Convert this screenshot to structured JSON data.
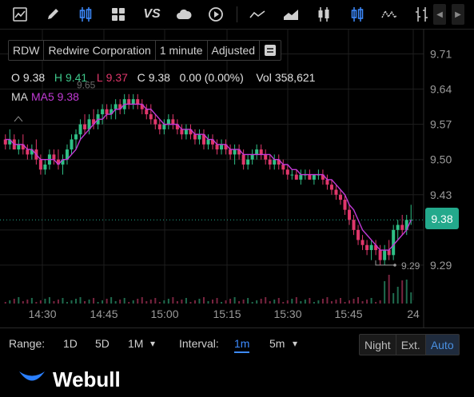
{
  "toolbar": {
    "icons": [
      "area-chart-icon",
      "draw-pen-icon",
      "candlestick-icon",
      "grid-layout-icon",
      "compare-vs-icon",
      "cloud-icon",
      "replay-icon",
      "line-chart-icon",
      "mountain-chart-icon",
      "bar-ohlc-icon",
      "candle-selected-icon",
      "wave-chart-icon",
      "hollow-candle-icon"
    ],
    "compare_label": "VS",
    "nav_left": "◀",
    "nav_right": "▶"
  },
  "info": {
    "symbol": "RDW",
    "name": "Redwire Corporation",
    "interval": "1 minute",
    "adjust": "Adjusted",
    "menu_icon": "≡"
  },
  "ohlc": {
    "o_label": "O",
    "o": "9.38",
    "h_label": "H",
    "h": "9.41",
    "l_label": "L",
    "l": "9.37",
    "c_label": "C",
    "c": "9.38",
    "change": "0.00 (0.00%)",
    "vol_label": "Vol",
    "vol": "358,621"
  },
  "ma": {
    "label": "MA",
    "value": "MA5 9.38"
  },
  "price_badge": "9.38",
  "chart_data": {
    "type": "candlestick",
    "y_ticks": [
      "9.71",
      "9.64",
      "9.57",
      "9.50",
      "9.43",
      "9.38",
      "9.29"
    ],
    "x_ticks": [
      "14:30",
      "14:45",
      "15:00",
      "15:15",
      "15:30",
      "15:45",
      "24"
    ],
    "high_label": "9.65",
    "low_label": "9.29",
    "last_price": 9.38,
    "colors": {
      "up": "#2fbf86",
      "down": "#e0376b",
      "ma": "#c23ad6",
      "grid": "#1e1e1e",
      "last": "#23a98c"
    },
    "candles": [
      [
        9.54,
        9.55,
        9.52,
        9.53
      ],
      [
        9.53,
        9.56,
        9.52,
        9.54
      ],
      [
        9.54,
        9.55,
        9.52,
        9.52
      ],
      [
        9.52,
        9.54,
        9.51,
        9.53
      ],
      [
        9.53,
        9.55,
        9.51,
        9.52
      ],
      [
        9.52,
        9.53,
        9.5,
        9.51
      ],
      [
        9.51,
        9.53,
        9.5,
        9.52
      ],
      [
        9.52,
        9.54,
        9.49,
        9.5
      ],
      [
        9.5,
        9.51,
        9.47,
        9.48
      ],
      [
        9.48,
        9.5,
        9.47,
        9.49
      ],
      [
        9.49,
        9.52,
        9.48,
        9.51
      ],
      [
        9.51,
        9.52,
        9.49,
        9.5
      ],
      [
        9.5,
        9.52,
        9.48,
        9.49
      ],
      [
        9.49,
        9.51,
        9.47,
        9.5
      ],
      [
        9.5,
        9.53,
        9.49,
        9.52
      ],
      [
        9.52,
        9.55,
        9.51,
        9.54
      ],
      [
        9.54,
        9.56,
        9.52,
        9.55
      ],
      [
        9.55,
        9.58,
        9.54,
        9.57
      ],
      [
        9.57,
        9.59,
        9.55,
        9.56
      ],
      [
        9.56,
        9.59,
        9.55,
        9.58
      ],
      [
        9.58,
        9.6,
        9.56,
        9.57
      ],
      [
        9.57,
        9.6,
        9.56,
        9.59
      ],
      [
        9.59,
        9.61,
        9.57,
        9.6
      ],
      [
        9.6,
        9.61,
        9.58,
        9.59
      ],
      [
        9.59,
        9.61,
        9.58,
        9.6
      ],
      [
        9.6,
        9.62,
        9.58,
        9.61
      ],
      [
        9.61,
        9.62,
        9.59,
        9.6
      ],
      [
        9.6,
        9.63,
        9.59,
        9.62
      ],
      [
        9.62,
        9.63,
        9.6,
        9.61
      ],
      [
        9.61,
        9.63,
        9.6,
        9.62
      ],
      [
        9.62,
        9.63,
        9.6,
        9.61
      ],
      [
        9.61,
        9.62,
        9.59,
        9.6
      ],
      [
        9.6,
        9.61,
        9.58,
        9.59
      ],
      [
        9.59,
        9.61,
        9.57,
        9.58
      ],
      [
        9.58,
        9.59,
        9.56,
        9.57
      ],
      [
        9.57,
        9.58,
        9.55,
        9.56
      ],
      [
        9.56,
        9.58,
        9.55,
        9.57
      ],
      [
        9.57,
        9.59,
        9.56,
        9.58
      ],
      [
        9.58,
        9.59,
        9.56,
        9.57
      ],
      [
        9.57,
        9.58,
        9.55,
        9.56
      ],
      [
        9.56,
        9.57,
        9.54,
        9.55
      ],
      [
        9.55,
        9.57,
        9.54,
        9.56
      ],
      [
        9.56,
        9.57,
        9.54,
        9.55
      ],
      [
        9.55,
        9.56,
        9.53,
        9.54
      ],
      [
        9.54,
        9.56,
        9.53,
        9.55
      ],
      [
        9.55,
        9.56,
        9.52,
        9.53
      ],
      [
        9.53,
        9.55,
        9.52,
        9.54
      ],
      [
        9.54,
        9.55,
        9.52,
        9.53
      ],
      [
        9.53,
        9.54,
        9.51,
        9.52
      ],
      [
        9.52,
        9.54,
        9.51,
        9.53
      ],
      [
        9.53,
        9.54,
        9.51,
        9.52
      ],
      [
        9.52,
        9.53,
        9.5,
        9.51
      ],
      [
        9.51,
        9.53,
        9.49,
        9.52
      ],
      [
        9.52,
        9.53,
        9.5,
        9.51
      ],
      [
        9.51,
        9.52,
        9.48,
        9.49
      ],
      [
        9.49,
        9.51,
        9.48,
        9.5
      ],
      [
        9.5,
        9.52,
        9.49,
        9.51
      ],
      [
        9.51,
        9.53,
        9.5,
        9.52
      ],
      [
        9.52,
        9.53,
        9.5,
        9.51
      ],
      [
        9.51,
        9.52,
        9.49,
        9.5
      ],
      [
        9.5,
        9.51,
        9.48,
        9.49
      ],
      [
        9.49,
        9.51,
        9.48,
        9.5
      ],
      [
        9.5,
        9.51,
        9.48,
        9.49
      ],
      [
        9.49,
        9.5,
        9.47,
        9.48
      ],
      [
        9.48,
        9.49,
        9.46,
        9.47
      ],
      [
        9.47,
        9.48,
        9.46,
        9.47
      ],
      [
        9.47,
        9.48,
        9.46,
        9.46
      ],
      [
        9.46,
        9.48,
        9.45,
        9.47
      ],
      [
        9.47,
        9.48,
        9.46,
        9.47
      ],
      [
        9.47,
        9.48,
        9.46,
        9.46
      ],
      [
        9.46,
        9.47,
        9.45,
        9.47
      ],
      [
        9.47,
        9.48,
        9.46,
        9.47
      ],
      [
        9.47,
        9.48,
        9.45,
        9.46
      ],
      [
        9.46,
        9.47,
        9.44,
        9.45
      ],
      [
        9.45,
        9.46,
        9.43,
        9.44
      ],
      [
        9.44,
        9.45,
        9.42,
        9.43
      ],
      [
        9.43,
        9.44,
        9.41,
        9.42
      ],
      [
        9.42,
        9.43,
        9.39,
        9.4
      ],
      [
        9.4,
        9.41,
        9.37,
        9.38
      ],
      [
        9.38,
        9.39,
        9.35,
        9.36
      ],
      [
        9.36,
        9.37,
        9.33,
        9.34
      ],
      [
        9.34,
        9.35,
        9.32,
        9.33
      ],
      [
        9.33,
        9.34,
        9.31,
        9.32
      ],
      [
        9.32,
        9.34,
        9.3,
        9.33
      ],
      [
        9.33,
        9.34,
        9.31,
        9.32
      ],
      [
        9.32,
        9.33,
        9.29,
        9.3
      ],
      [
        9.3,
        9.33,
        9.29,
        9.32
      ],
      [
        9.32,
        9.34,
        9.3,
        9.31
      ],
      [
        9.31,
        9.37,
        9.3,
        9.36
      ],
      [
        9.36,
        9.38,
        9.34,
        9.37
      ],
      [
        9.37,
        9.39,
        9.35,
        9.36
      ],
      [
        9.36,
        9.39,
        9.35,
        9.38
      ],
      [
        9.38,
        9.41,
        9.37,
        9.38
      ]
    ],
    "ma5": [
      9.54,
      9.54,
      9.53,
      9.53,
      9.53,
      9.52,
      9.52,
      9.51,
      9.5,
      9.5,
      9.5,
      9.5,
      9.49,
      9.5,
      9.5,
      9.51,
      9.52,
      9.54,
      9.55,
      9.56,
      9.57,
      9.58,
      9.58,
      9.59,
      9.59,
      9.6,
      9.6,
      9.61,
      9.61,
      9.61,
      9.61,
      9.61,
      9.6,
      9.6,
      9.59,
      9.58,
      9.57,
      9.57,
      9.57,
      9.57,
      9.56,
      9.56,
      9.56,
      9.55,
      9.55,
      9.55,
      9.54,
      9.54,
      9.53,
      9.53,
      9.53,
      9.52,
      9.52,
      9.52,
      9.51,
      9.51,
      9.51,
      9.51,
      9.51,
      9.51,
      9.51,
      9.5,
      9.5,
      9.49,
      9.49,
      9.48,
      9.48,
      9.47,
      9.47,
      9.47,
      9.47,
      9.47,
      9.47,
      9.46,
      9.46,
      9.45,
      9.44,
      9.43,
      9.41,
      9.4,
      9.38,
      9.36,
      9.35,
      9.34,
      9.33,
      9.32,
      9.32,
      9.32,
      9.33,
      9.34,
      9.35,
      9.36,
      9.38
    ]
  },
  "bottom": {
    "range_label": "Range:",
    "ranges": [
      "1D",
      "5D",
      "1M"
    ],
    "range_dropdown_icon": "▾",
    "interval_label": "Interval:",
    "interval_active": "1m",
    "interval_other": "5m",
    "interval_dropdown_icon": "▾",
    "sessions": [
      "Night",
      "Ext.",
      "Auto"
    ]
  },
  "footer": {
    "brand": "Webull"
  }
}
